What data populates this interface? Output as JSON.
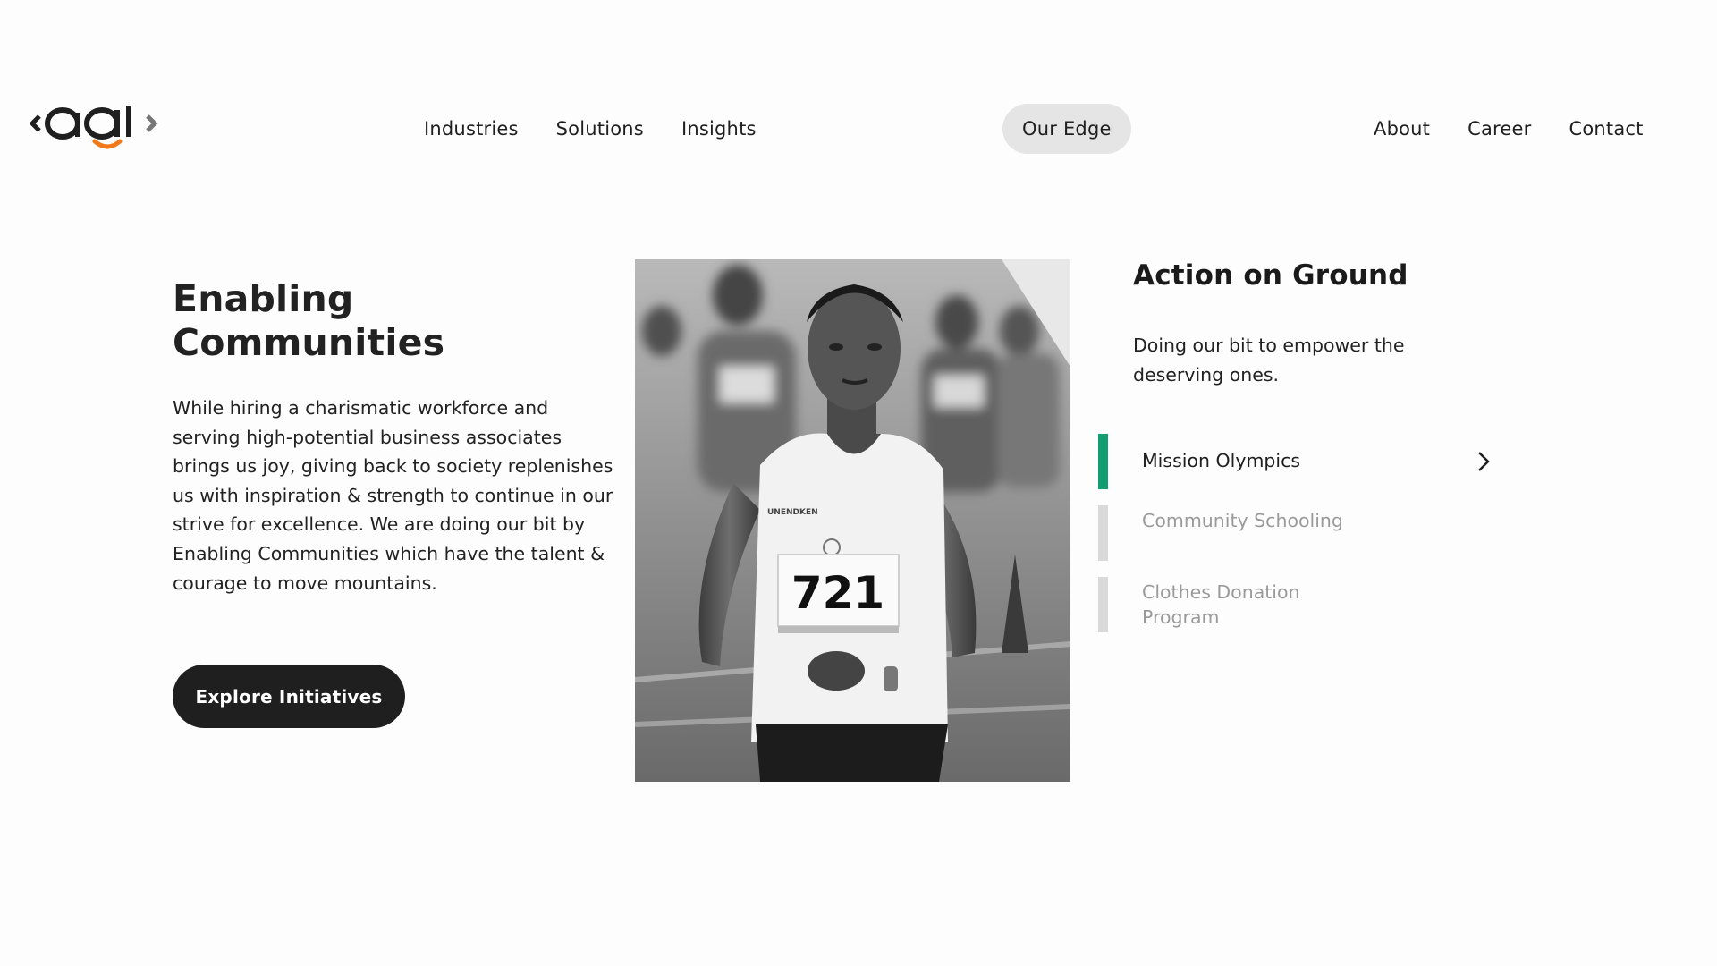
{
  "header": {
    "logo_alt": "aqi logo",
    "nav_left": [
      "Industries",
      "Solutions",
      "Insights"
    ],
    "nav_center": "Our Edge",
    "nav_right": [
      "About",
      "Career",
      "Contact"
    ]
  },
  "main": {
    "headline_line1": "Enabling",
    "headline_line2": "Communities",
    "body": "While hiring a charismatic workforce and serving high-potential business associates brings us joy, giving back to society replenishes us with inspiration & strength to continue in our strive for excellence. We are doing our bit by Enabling Communities which have the talent & courage to move mountains.",
    "cta_label": "Explore Initiatives",
    "photo_bib": "721",
    "photo_vest_text": "UNENDKEN"
  },
  "aside": {
    "title": "Action on Ground",
    "subtitle": "Doing our bit to empower the deserving ones.",
    "initiatives": [
      {
        "label": "Mission Olympics",
        "active": true
      },
      {
        "label": "Community Schooling",
        "active": false
      },
      {
        "label": "Clothes Donation Program",
        "active": false
      }
    ]
  },
  "colors": {
    "accent_green": "#139e72",
    "logo_orange": "#f07a1a",
    "button_dark": "#1f1f1f",
    "pill_bg": "#e5e5e5"
  }
}
